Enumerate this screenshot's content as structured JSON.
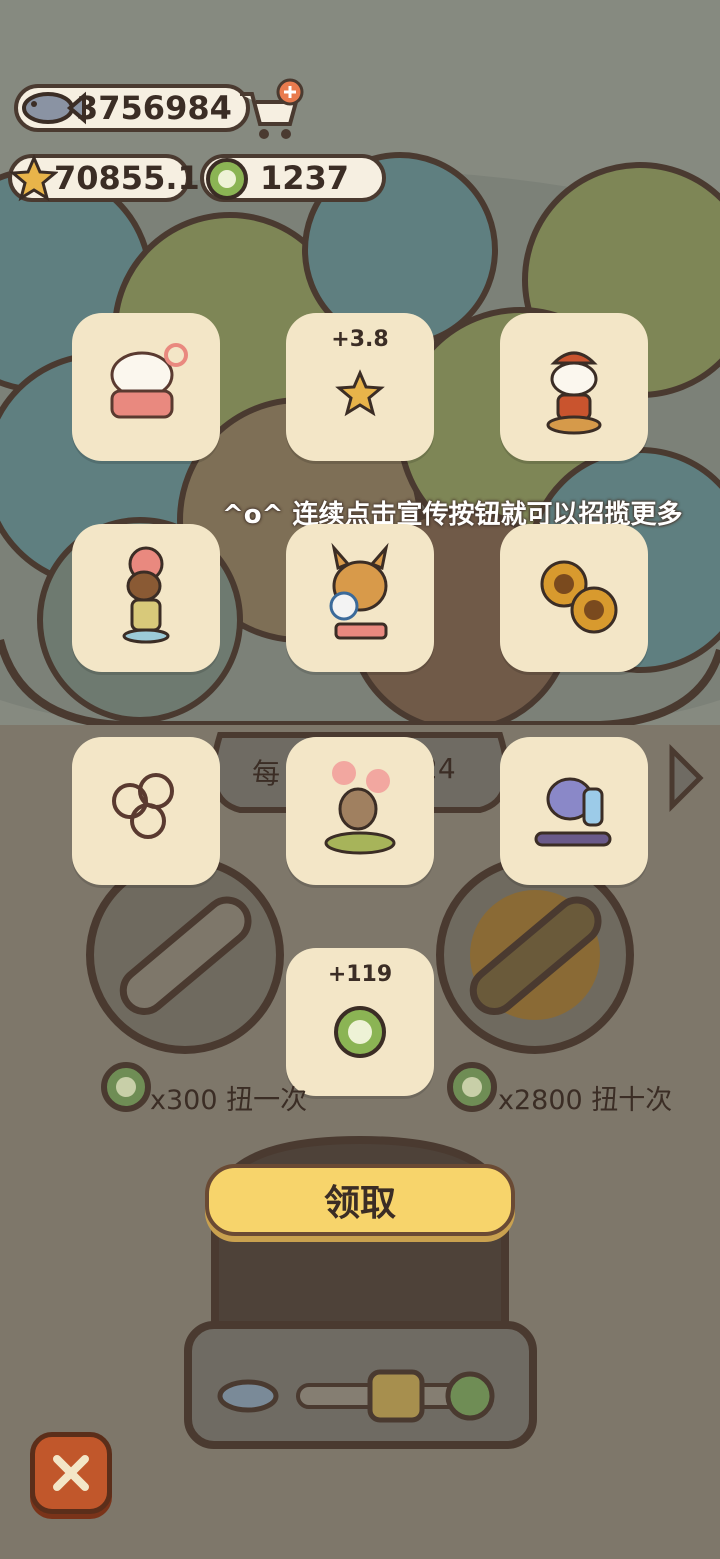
{
  "currency": {
    "fish": "3756984",
    "stars": "70855.1",
    "coins": "1237"
  },
  "rewards": [
    {
      "icon": "nurse-cat-figure-icon",
      "label": ""
    },
    {
      "icon": "star-icon",
      "label": "+3.8"
    },
    {
      "icon": "plumber-dog-figure-icon",
      "label": ""
    },
    {
      "icon": "flower-dog-figure-icon",
      "label": ""
    },
    {
      "icon": "lynx-volleyball-figure-icon",
      "label": ""
    },
    {
      "icon": "sunflower-cookie-icon",
      "label": ""
    },
    {
      "icon": "ring-pile-icon",
      "label": ""
    },
    {
      "icon": "sloth-blossom-figure-icon",
      "label": ""
    },
    {
      "icon": "raccoon-skate-figure-icon",
      "label": ""
    },
    {
      "icon": "green-coin-icon",
      "label": "+119"
    }
  ],
  "hint": "^o^ 连续点击宣传按钮就可以招揽更多",
  "background": {
    "partial_left": "每",
    "partial_right": "24"
  },
  "spin_options": {
    "single": "x300 扭一次",
    "ten": "x2800 扭十次"
  },
  "claim_label": "领取",
  "colors": {
    "tile": "#f3e6c7",
    "claim": "#f7d46b",
    "close": "#c1572b",
    "coin_green": "#8bb454"
  }
}
